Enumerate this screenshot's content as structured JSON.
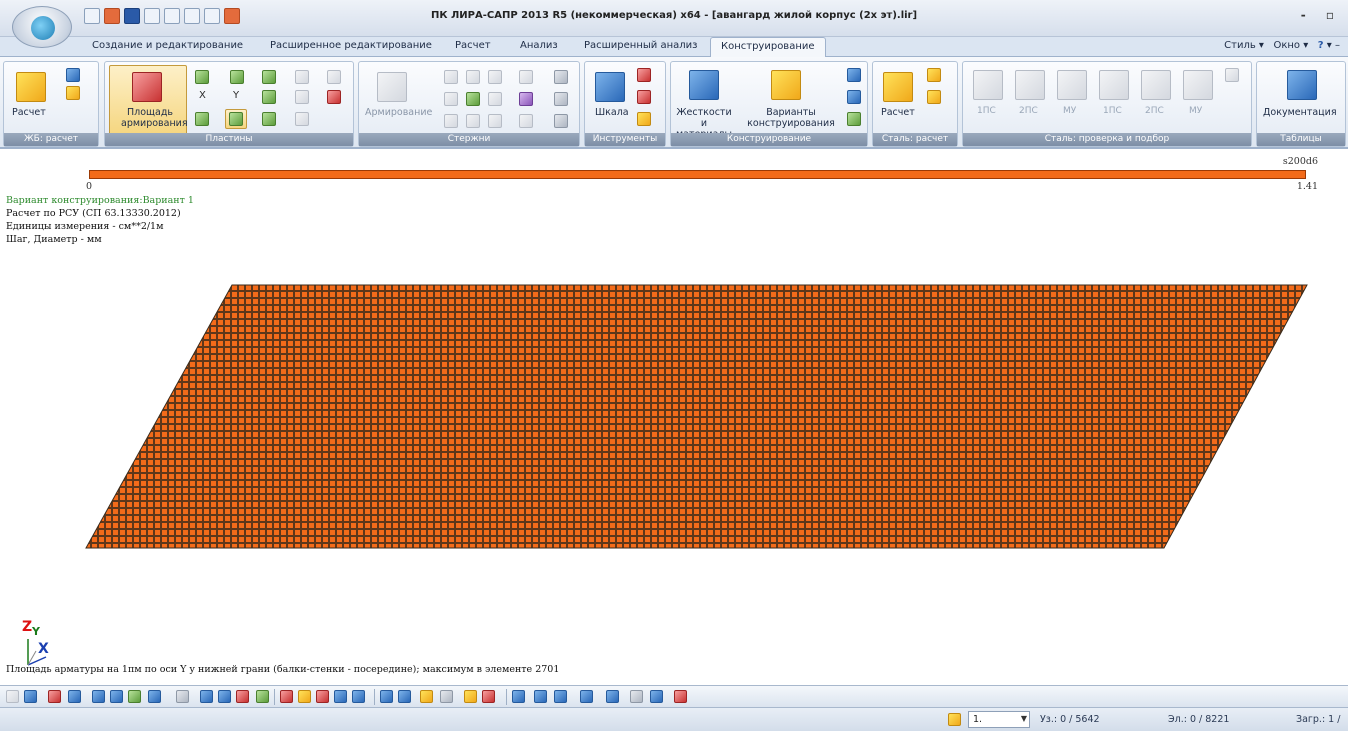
{
  "window": {
    "title": "ПК ЛИРА-САПР  2013 R5 (некоммерческая) x64 - [авангард жилой корпус (2х эт).lir]",
    "controls": "- ▫"
  },
  "tabs": [
    {
      "label": "Создание и редактирование"
    },
    {
      "label": "Расширенное редактирование"
    },
    {
      "label": "Расчет"
    },
    {
      "label": "Анализ"
    },
    {
      "label": "Расширенный анализ"
    },
    {
      "label": "Конструирование",
      "active": true
    }
  ],
  "tabs_right": {
    "style": "Стиль",
    "window": "Окно",
    "help": "?"
  },
  "ribbon": {
    "groups": [
      {
        "label": "ЖБ: расчет",
        "buttons": [
          "Расчет"
        ]
      },
      {
        "label": "Пластины",
        "buttons": [
          "Площадь армирования"
        ],
        "letters": [
          "X",
          "Y"
        ]
      },
      {
        "label": "Стержни",
        "buttons": [
          "Армирование"
        ]
      },
      {
        "label": "Инструменты",
        "buttons": [
          "Шкала"
        ]
      },
      {
        "label": "Конструирование",
        "buttons": [
          "Жесткости и материалы",
          "Варианты конструирования"
        ]
      },
      {
        "label": "Сталь: расчет",
        "buttons": [
          "Расчет"
        ]
      },
      {
        "label": "Сталь: проверка и подбор",
        "buttons": [
          "1ПС",
          "2ПС",
          "МУ",
          "1ПС",
          "2ПС",
          "МУ"
        ]
      },
      {
        "label": "Таблицы",
        "buttons": [
          "Документация"
        ]
      }
    ]
  },
  "scale": {
    "label": "s200d6",
    "min": "0",
    "max": "1.41",
    "color": "#f36b1a"
  },
  "info": {
    "variant": "Вариант конструирования:Вариант 1",
    "calc": "Расчет по РСУ (СП 63.13330.2012)",
    "units": "Единицы измерения - см**2/1м",
    "step": "Шаг, Диаметр - мм"
  },
  "mesh": {
    "fill": "#f36b1a",
    "edge": "#3a2a1a"
  },
  "axes": {
    "z": "Z",
    "y": "Y",
    "x": "X"
  },
  "caption": "Площадь арматуры на 1пм по оси Y у нижней грани (балки-стенки - посередине); максимум в элементе 2701",
  "status": {
    "scale_value": "1.",
    "nodes": "Уз.: 0 / 5642",
    "elements": "Эл.: 0 / 8221",
    "loads": "Загр.: 1 /"
  }
}
